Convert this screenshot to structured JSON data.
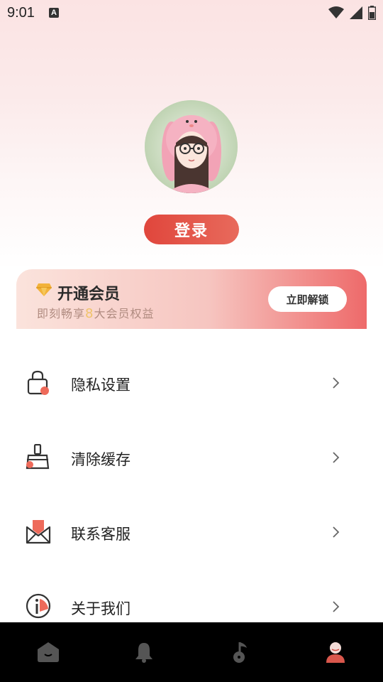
{
  "status_bar": {
    "time": "9:01",
    "indicator": "A"
  },
  "profile": {
    "login_label": "登录"
  },
  "vip": {
    "title": "开通会员",
    "subtitle_prefix": "即刻畅享",
    "subtitle_number": "8",
    "subtitle_suffix": "大会员权益",
    "button_label": "立即解锁"
  },
  "menu": [
    {
      "label": "隐私设置",
      "icon": "lock-icon"
    },
    {
      "label": "清除缓存",
      "icon": "broom-icon"
    },
    {
      "label": "联系客服",
      "icon": "mail-icon"
    },
    {
      "label": "关于我们",
      "icon": "info-icon"
    }
  ],
  "tabbar": [
    {
      "icon": "home-icon",
      "active": false
    },
    {
      "icon": "bell-icon",
      "active": false
    },
    {
      "icon": "music-icon",
      "active": false
    },
    {
      "icon": "profile-icon",
      "active": true
    }
  ],
  "colors": {
    "accent": "#e0463c",
    "tab_active": "#e0574c",
    "tab_inactive": "#555555"
  }
}
